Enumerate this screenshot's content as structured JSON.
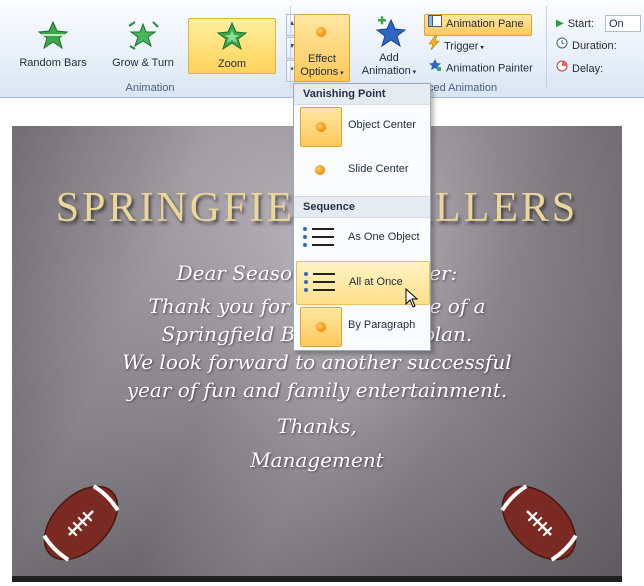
{
  "ribbon": {
    "animation_gallery": [
      {
        "label": "Random Bars",
        "icon": "random-bars-star-icon",
        "selected": false
      },
      {
        "label": "Grow & Turn",
        "icon": "grow-turn-star-icon",
        "selected": false
      },
      {
        "label": "Zoom",
        "icon": "zoom-star-icon",
        "selected": true
      }
    ],
    "group_animation": "Animation",
    "group_advanced_partial": "ced Animation",
    "effect_options": {
      "line1": "Effect",
      "line2": "Options"
    },
    "add_animation": {
      "line1": "Add",
      "line2": "Animation"
    },
    "animation_pane": "Animation Pane",
    "trigger": "Trigger",
    "animation_painter": "Animation Painter",
    "timing": {
      "start_label": "Start:",
      "start_value": "On",
      "duration_label": "Duration:",
      "delay_label": "Delay:"
    }
  },
  "menu": {
    "vanishing_point_header": "Vanishing Point",
    "items_vanishing": [
      {
        "label": "Object Center",
        "selected": true
      },
      {
        "label": "Slide Center",
        "selected": false
      }
    ],
    "sequence_header": "Sequence",
    "items_sequence": [
      {
        "label": "As One Object",
        "selected": false
      },
      {
        "label": "All at Once",
        "selected": false,
        "hover": true
      },
      {
        "label": "By Paragraph",
        "selected": true
      }
    ]
  },
  "slide": {
    "title": "SPRINGFIELD BALLERS",
    "lines": [
      "Dear Season Ticket Holder:",
      "Thank you for your purchase of a",
      "Springfield Ballers ticket plan.",
      "We look forward to another successful",
      "year of fun and family entertainment.",
      "Thanks,",
      "Management"
    ]
  },
  "colors": {
    "accent_selected": "#ffc95a",
    "title_gold": "#ecd79a",
    "ribbon_bg": "#e4edf8"
  }
}
